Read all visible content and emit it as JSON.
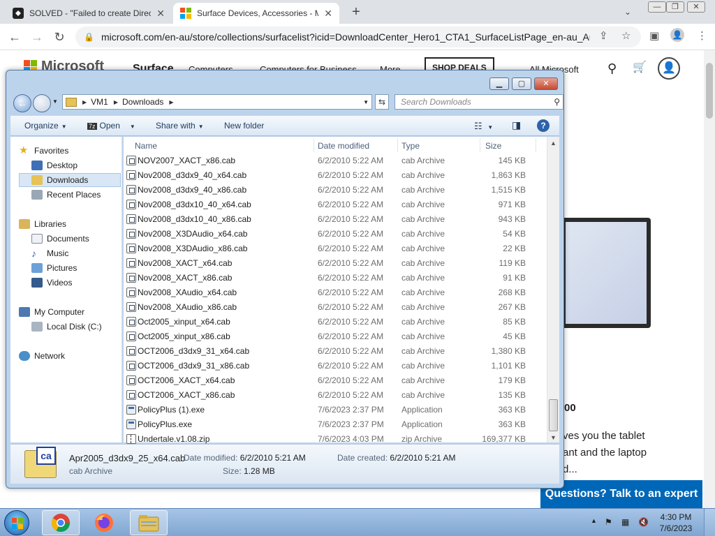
{
  "browser": {
    "tabs": [
      {
        "title": "SOLVED - \"Failed to create Direct",
        "favicon": "solved-site-icon",
        "active": false
      },
      {
        "title": "Surface Devices, Accessories - M",
        "favicon": "microsoft-icon",
        "active": true
      }
    ],
    "close_glyph": "✕",
    "new_tab": "+",
    "url": "microsoft.com/en-au/store/collections/surfacelist?icid=DownloadCenter_Hero1_CTA1_SurfaceListPage_en-au_Au..."
  },
  "webpage": {
    "brand": "Microsoft",
    "nav": [
      "Surface",
      "Computers",
      "Computers for Business",
      "More",
      "All Microsoft"
    ],
    "shop_deals": "SHOP DEALS",
    "price_fragment": "00",
    "text_lines": [
      "ves you the tablet",
      "ant and the laptop",
      "d..."
    ],
    "expert_button": "Questions? Talk to an expert",
    "accent": "#0067b8"
  },
  "explorer": {
    "path": [
      "VM1",
      "Downloads"
    ],
    "search_placeholder": "Search Downloads",
    "toolbar": {
      "organize": "Organize",
      "open": "Open",
      "share_with": "Share with",
      "new_folder": "New folder"
    },
    "nav": {
      "favorites": "Favorites",
      "favorites_items": [
        "Desktop",
        "Downloads",
        "Recent Places"
      ],
      "libraries": "Libraries",
      "libraries_items": [
        "Documents",
        "Music",
        "Pictures",
        "Videos"
      ],
      "computer": "My Computer",
      "computer_items": [
        "Local Disk (C:)"
      ],
      "network": "Network",
      "selected": "Downloads"
    },
    "columns": {
      "name": "Name",
      "date": "Date modified",
      "type": "Type",
      "size": "Size"
    },
    "files": [
      {
        "name": "NOV2007_XACT_x86.cab",
        "date": "6/2/2010 5:22 AM",
        "type": "cab Archive",
        "size": "145 KB",
        "icon": "cab"
      },
      {
        "name": "Nov2008_d3dx9_40_x64.cab",
        "date": "6/2/2010 5:22 AM",
        "type": "cab Archive",
        "size": "1,863 KB",
        "icon": "cab"
      },
      {
        "name": "Nov2008_d3dx9_40_x86.cab",
        "date": "6/2/2010 5:22 AM",
        "type": "cab Archive",
        "size": "1,515 KB",
        "icon": "cab"
      },
      {
        "name": "Nov2008_d3dx10_40_x64.cab",
        "date": "6/2/2010 5:22 AM",
        "type": "cab Archive",
        "size": "971 KB",
        "icon": "cab"
      },
      {
        "name": "Nov2008_d3dx10_40_x86.cab",
        "date": "6/2/2010 5:22 AM",
        "type": "cab Archive",
        "size": "943 KB",
        "icon": "cab"
      },
      {
        "name": "Nov2008_X3DAudio_x64.cab",
        "date": "6/2/2010 5:22 AM",
        "type": "cab Archive",
        "size": "54 KB",
        "icon": "cab"
      },
      {
        "name": "Nov2008_X3DAudio_x86.cab",
        "date": "6/2/2010 5:22 AM",
        "type": "cab Archive",
        "size": "22 KB",
        "icon": "cab"
      },
      {
        "name": "Nov2008_XACT_x64.cab",
        "date": "6/2/2010 5:22 AM",
        "type": "cab Archive",
        "size": "119 KB",
        "icon": "cab"
      },
      {
        "name": "Nov2008_XACT_x86.cab",
        "date": "6/2/2010 5:22 AM",
        "type": "cab Archive",
        "size": "91 KB",
        "icon": "cab"
      },
      {
        "name": "Nov2008_XAudio_x64.cab",
        "date": "6/2/2010 5:22 AM",
        "type": "cab Archive",
        "size": "268 KB",
        "icon": "cab"
      },
      {
        "name": "Nov2008_XAudio_x86.cab",
        "date": "6/2/2010 5:22 AM",
        "type": "cab Archive",
        "size": "267 KB",
        "icon": "cab"
      },
      {
        "name": "Oct2005_xinput_x64.cab",
        "date": "6/2/2010 5:22 AM",
        "type": "cab Archive",
        "size": "85 KB",
        "icon": "cab"
      },
      {
        "name": "Oct2005_xinput_x86.cab",
        "date": "6/2/2010 5:22 AM",
        "type": "cab Archive",
        "size": "45 KB",
        "icon": "cab"
      },
      {
        "name": "OCT2006_d3dx9_31_x64.cab",
        "date": "6/2/2010 5:22 AM",
        "type": "cab Archive",
        "size": "1,380 KB",
        "icon": "cab"
      },
      {
        "name": "OCT2006_d3dx9_31_x86.cab",
        "date": "6/2/2010 5:22 AM",
        "type": "cab Archive",
        "size": "1,101 KB",
        "icon": "cab"
      },
      {
        "name": "OCT2006_XACT_x64.cab",
        "date": "6/2/2010 5:22 AM",
        "type": "cab Archive",
        "size": "179 KB",
        "icon": "cab"
      },
      {
        "name": "OCT2006_XACT_x86.cab",
        "date": "6/2/2010 5:22 AM",
        "type": "cab Archive",
        "size": "135 KB",
        "icon": "cab"
      },
      {
        "name": "PolicyPlus (1).exe",
        "date": "7/6/2023 2:37 PM",
        "type": "Application",
        "size": "363 KB",
        "icon": "app"
      },
      {
        "name": "PolicyPlus.exe",
        "date": "7/6/2023 2:37 PM",
        "type": "Application",
        "size": "363 KB",
        "icon": "app"
      },
      {
        "name": "Undertale.v1.08.zip",
        "date": "7/6/2023 4:03 PM",
        "type": "zip Archive",
        "size": "169,377 KB",
        "icon": "zip"
      }
    ],
    "details": {
      "icon_letters": "ca",
      "filename": "Apr2005_d3dx9_25_x64.cab",
      "type": "cab Archive",
      "date_modified_label": "Date modified:",
      "date_modified": "6/2/2010 5:21 AM",
      "date_created_label": "Date created:",
      "date_created": "6/2/2010 5:21 AM",
      "size_label": "Size:",
      "size": "1.28 MB"
    }
  },
  "taskbar": {
    "apps": [
      "chrome-icon",
      "firefox-icon",
      "explorer-folder-icon"
    ],
    "time": "4:30 PM",
    "date": "7/6/2023"
  }
}
